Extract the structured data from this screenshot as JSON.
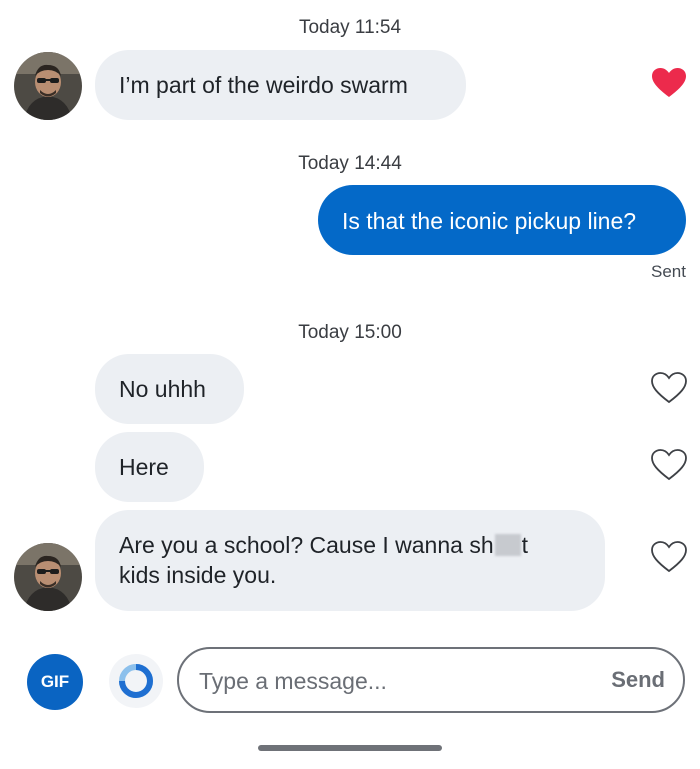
{
  "colors": {
    "incoming_bubble": "#eceff3",
    "outgoing_bubble": "#0469c8",
    "accent_blue": "#0a64c2",
    "heart_liked": "#ec2a4c"
  },
  "messages": [
    {
      "timestamp": "Today 11:54",
      "direction": "incoming",
      "text": "I’m part of the weirdo swarm",
      "liked": true,
      "avatar": "profile-photo"
    },
    {
      "timestamp": "Today 14:44",
      "direction": "outgoing",
      "text": "Is that the iconic pickup line?",
      "status": "Sent"
    },
    {
      "timestamp": "Today 15:00",
      "direction": "incoming",
      "text": "No uhhh",
      "liked": false
    },
    {
      "direction": "incoming",
      "text": "Here",
      "liked": false
    },
    {
      "direction": "incoming",
      "text_line1_pre": "Are you a school? Cause I wanna sh",
      "text_line1_post": "t",
      "text_line2": "kids inside you.",
      "redacted": true,
      "liked": false,
      "avatar": "profile-photo"
    }
  ],
  "composer": {
    "gif_label": "GIF",
    "placeholder": "Type a message...",
    "send_label": "Send",
    "icons": [
      "gif-icon",
      "ring-icon"
    ]
  }
}
